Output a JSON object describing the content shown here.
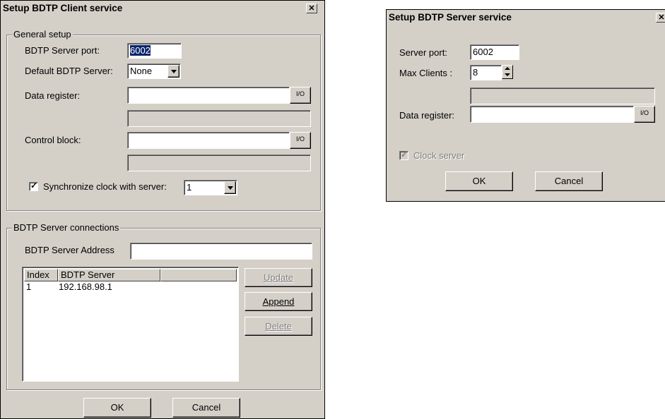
{
  "client": {
    "title": "Setup BDTP Client service",
    "close": "✕",
    "general_legend": "General setup",
    "server_port_label": "BDTP Server port:",
    "server_port_value": "6002",
    "default_server_label": "Default BDTP Server:",
    "default_server_value": "None",
    "data_register_label": "Data register:",
    "data_register_value": "",
    "data_register_io": "I/O",
    "data_register_desc": "",
    "control_block_label": "Control block:",
    "control_block_value": "",
    "control_block_io": "I/O",
    "control_block_desc": "",
    "sync_label": "Synchronize clock with server:",
    "sync_checked": true,
    "sync_server_value": "1",
    "connections_legend": "BDTP Server connections",
    "server_address_label": "BDTP Server Address",
    "server_address_value": "",
    "columns": [
      "Index",
      "BDTP Server",
      ""
    ],
    "rows": [
      {
        "index": "1",
        "server": "192.168.98.1"
      }
    ],
    "update_button": "Update",
    "append_button": "Append",
    "delete_button": "Delete",
    "ok_button": "OK",
    "cancel_button": "Cancel"
  },
  "server": {
    "title": "Setup BDTP Server service",
    "close": "✕",
    "port_label": "Server port:",
    "port_value": "6002",
    "max_clients_label": "Max Clients :",
    "max_clients_value": "8",
    "data_register_label": "Data register:",
    "data_register_value": "",
    "data_register_io": "I/O",
    "data_register_desc": "",
    "clock_server_label": "Clock server",
    "clock_server_checked": true,
    "ok_button": "OK",
    "cancel_button": "Cancel"
  }
}
